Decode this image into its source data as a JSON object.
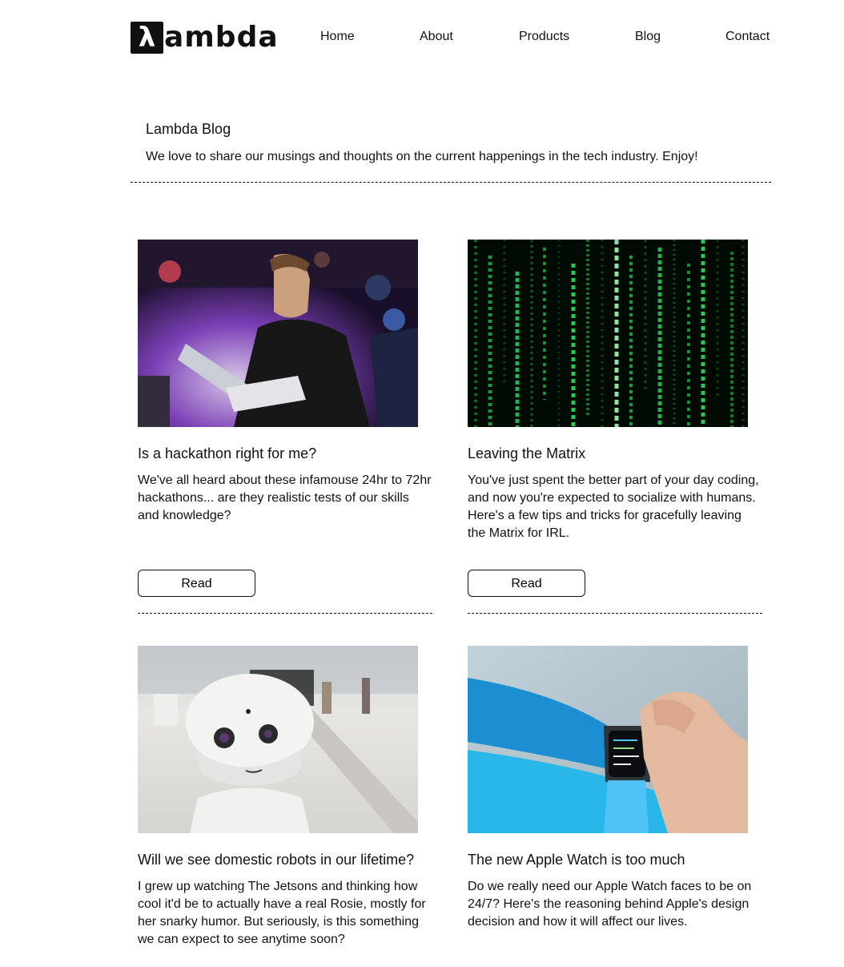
{
  "brand": {
    "logo_glyph": "λ",
    "logo_text": "ambda"
  },
  "nav": {
    "items": [
      {
        "label": "Home"
      },
      {
        "label": "About"
      },
      {
        "label": "Products"
      },
      {
        "label": "Blog"
      },
      {
        "label": "Contact"
      }
    ]
  },
  "intro": {
    "title": "Lambda Blog",
    "description": "We love to share our musings and thoughts on the current happenings in the tech industry. Enjoy!"
  },
  "posts": [
    {
      "title": "Is a hackathon right for me?",
      "body": "We've all heard about these infamouse 24hr to 72hr hackathons... are they realistic tests of our skills and knowledge?",
      "button_label": "Read",
      "image_icon": "hackathon-photo"
    },
    {
      "title": "Leaving the Matrix",
      "body": "You've just spent the better part of your day coding, and now you're expected to socialize with humans. Here's a few tips and tricks for gracefully leaving the Matrix for IRL.",
      "button_label": "Read",
      "image_icon": "matrix-code-photo"
    },
    {
      "title": "Will we see domestic robots in our lifetime?",
      "body": "I grew up watching The Jetsons and thinking how cool it'd be to actually have a real Rosie, mostly for her snarky humor. But seriously, is this something we can expect to see anytime soon?",
      "image_icon": "robot-photo"
    },
    {
      "title": "The new Apple Watch is too much",
      "body": "Do we really need our Apple Watch faces to be on 24/7? Here's the reasoning behind Apple's design decision and how it will affect our lives.",
      "image_icon": "apple-watch-photo"
    }
  ]
}
